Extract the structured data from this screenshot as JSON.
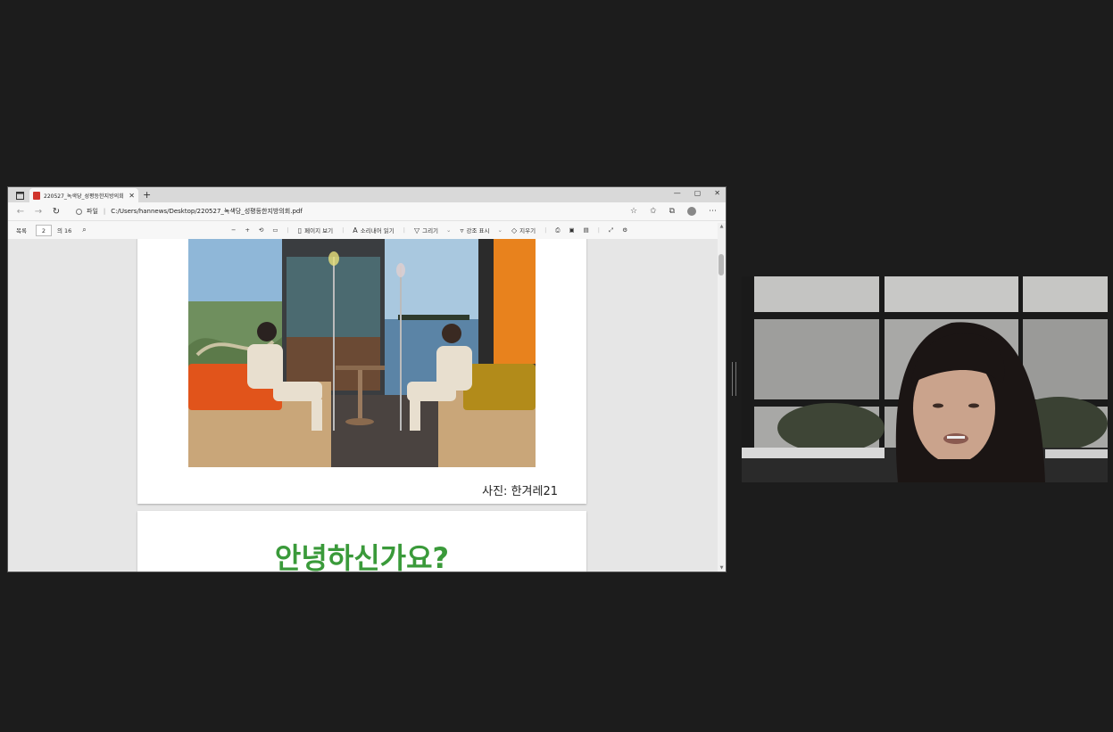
{
  "browser": {
    "tab_title": "220527_녹색당_성평등한지방의회",
    "new_tab": "+",
    "window_controls": [
      "—",
      "▢",
      "✕"
    ],
    "address_prefix": "파일",
    "address_url": "C:/Users/hannews/Desktop/220527_녹색당_성평등한지방의회.pdf"
  },
  "pdf_toolbar": {
    "page_label": "목록",
    "current_page": "2",
    "total_pages": "의 16",
    "tools": [
      {
        "icon": "page-view-icon",
        "label": "페이지 보기"
      },
      {
        "icon": "read-aloud-icon",
        "label": "소리내어 읽기"
      },
      {
        "icon": "draw-icon",
        "label": "그리기"
      },
      {
        "icon": "highlight-icon",
        "label": "강조 표시"
      },
      {
        "icon": "eraser-icon",
        "label": "지우기"
      }
    ]
  },
  "document": {
    "photo_caption": "사진: 한겨레21",
    "greeting": "안녕하신가요?"
  },
  "colors": {
    "greeting_green": "#3a9a3a",
    "background": "#1c1c1c"
  }
}
